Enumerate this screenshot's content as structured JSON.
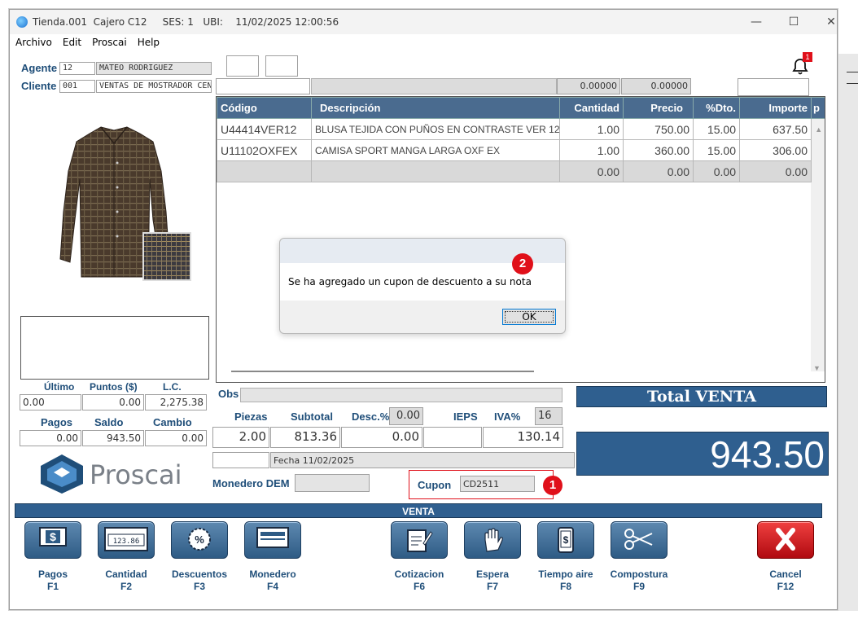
{
  "window": {
    "title": "Tienda.001  Cajero C12     SES: 1   UBI:    11/02/2025 12:00:56",
    "controls": {
      "minimize": "—",
      "maximize": "☐",
      "close": "✕"
    }
  },
  "menu": [
    "Archivo",
    "Edit",
    "Proscai",
    "Help"
  ],
  "customer": {
    "agente_label": "Agente",
    "agente_code": "12",
    "agente_name": "MATEO RODRIGUEZ",
    "cliente_label": "Cliente",
    "cliente_code": "001",
    "cliente_name": "VENTAS DE MOSTRADOR CEN"
  },
  "notifications": {
    "badge": "1"
  },
  "grid": {
    "totals_row": {
      "cantidad": "0.00000",
      "precio": "0.00000"
    },
    "headers": [
      "Código",
      "Descripción",
      "Cantidad",
      "Precio",
      "%Dto.",
      "Importe",
      "p"
    ],
    "rows": [
      {
        "codigo": "U44414VER12",
        "descripcion": "BLUSA TEJIDA CON PUÑOS EN CONTRASTE VER 12",
        "cantidad": "1.00",
        "precio": "750.00",
        "dto": "15.00",
        "importe": "637.50"
      },
      {
        "codigo": "U11102OXFEX",
        "descripcion": "CAMISA SPORT MANGA LARGA OXF EX",
        "cantidad": "1.00",
        "precio": "360.00",
        "dto": "15.00",
        "importe": "306.00"
      },
      {
        "codigo": "",
        "descripcion": "",
        "cantidad": "0.00",
        "precio": "0.00",
        "dto": "0.00",
        "importe": "0.00"
      }
    ]
  },
  "dialog": {
    "message": "Se ha agregado un cupon de descuento a su nota",
    "ok": "OK",
    "callout": "2"
  },
  "points": {
    "ultimo_label": "Último",
    "puntos_label": "Puntos ($)",
    "lc_label": "L.C.",
    "ultimo": "0.00",
    "puntos": "0.00",
    "lc": "2,275.38",
    "pagos_label": "Pagos",
    "saldo_label": "Saldo",
    "cambio_label": "Cambio",
    "pagos": "0.00",
    "saldo": "943.50",
    "cambio": "0.00"
  },
  "brand": {
    "name": "Proscai"
  },
  "summary": {
    "obs_label": "Obs",
    "piezas_label": "Piezas",
    "subtotal_label": "Subtotal",
    "desc_label": "Desc.%",
    "desc_pct": "0.00",
    "ieps_label": "IEPS",
    "iva_label": "IVA%",
    "iva_pct": "16",
    "piezas": "2.00",
    "subtotal": "813.36",
    "descuento": "0.00",
    "iva": "130.14",
    "fecha": "Fecha 11/02/2025",
    "monedero_label": "Monedero DEM",
    "cupon_label": "Cupon",
    "cupon_value": "CD2511",
    "cupon_callout": "1"
  },
  "total": {
    "label": "Total VENTA",
    "amount": "943.50"
  },
  "mode_bar": "VENTA",
  "actions": [
    {
      "label": "Pagos",
      "key": "F1",
      "icon": "dollar-bill-icon"
    },
    {
      "label": "Cantidad",
      "key": "F2",
      "icon": "calculator-icon"
    },
    {
      "label": "Descuentos",
      "key": "F3",
      "icon": "percent-badge-icon"
    },
    {
      "label": "Monedero",
      "key": "F4",
      "icon": "wallet-card-icon"
    },
    {
      "label": "Cotizacion",
      "key": "F6",
      "icon": "edit-document-icon"
    },
    {
      "label": "Espera",
      "key": "F7",
      "icon": "hand-stop-icon"
    },
    {
      "label": "Tiempo aire",
      "key": "F8",
      "icon": "mobile-phone-icon"
    },
    {
      "label": "Compostura",
      "key": "F9",
      "icon": "scissors-icon"
    },
    {
      "label": "Cancel",
      "key": "F12",
      "icon": "cancel-x-icon"
    }
  ],
  "calculator_display": "123.86",
  "colors": {
    "header_blue": "#4a6b8f",
    "label_blue": "#1f4e79",
    "total_bg": "#2f5f8f",
    "callout_red": "#e0101a",
    "cancel_red": "#d9141c"
  }
}
